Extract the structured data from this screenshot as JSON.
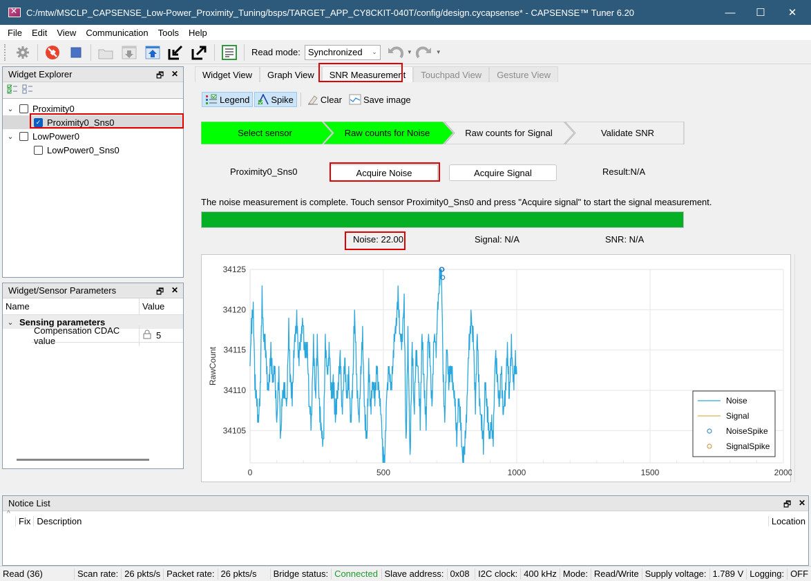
{
  "window": {
    "title": "C:/mtw/MSCLP_CAPSENSE_Low-Power_Proximity_Tuning/bsps/TARGET_APP_CY8CKIT-040T/config/design.cycapsense* - CAPSENSE™ Tuner 6.20",
    "minimize": "—",
    "maximize": "☐",
    "close": "✕"
  },
  "menu": [
    "File",
    "Edit",
    "View",
    "Communication",
    "Tools",
    "Help"
  ],
  "toolbar": {
    "icons": [
      "gear-icon",
      "disconnect-icon",
      "stop-icon",
      "open-folder-icon",
      "read-from-device-icon",
      "write-to-device-icon",
      "import-icon",
      "export-icon",
      "log-icon"
    ],
    "read_mode_label": "Read mode:",
    "read_mode_value": "Synchronized",
    "undo": "undo-icon",
    "redo": "redo-icon"
  },
  "widget_explorer": {
    "title": "Widget Explorer",
    "tree": [
      {
        "label": "Proximity0",
        "checked": false,
        "expanded": true,
        "children": [
          {
            "label": "Proximity0_Sns0",
            "checked": true,
            "selected": true
          }
        ]
      },
      {
        "label": "LowPower0",
        "checked": false,
        "expanded": true,
        "children": [
          {
            "label": "LowPower0_Sns0",
            "checked": false
          }
        ]
      }
    ]
  },
  "sensor_params": {
    "title": "Widget/Sensor Parameters",
    "col_name": "Name",
    "col_value": "Value",
    "group": "Sensing parameters",
    "rows": [
      {
        "name": "Compensation CDAC value",
        "value": "5",
        "locked": true
      }
    ]
  },
  "tabs": [
    {
      "label": "Widget View",
      "state": "normal"
    },
    {
      "label": "Graph View",
      "state": "normal"
    },
    {
      "label": "SNR Measurement",
      "state": "active"
    },
    {
      "label": "Touchpad View",
      "state": "disabled"
    },
    {
      "label": "Gesture View",
      "state": "disabled"
    }
  ],
  "snr_toolbar": {
    "legend": "Legend",
    "spike": "Spike",
    "clear": "Clear",
    "save_image": "Save image"
  },
  "steps": [
    {
      "label": "Select sensor",
      "done": true
    },
    {
      "label": "Raw counts for Noise",
      "done": true
    },
    {
      "label": "Raw counts for Signal",
      "done": false
    },
    {
      "label": "Validate SNR",
      "done": false
    }
  ],
  "measurement": {
    "sensor": "Proximity0_Sns0",
    "acquire_noise": "Acquire Noise",
    "acquire_signal": "Acquire Signal",
    "result": "Result:N/A",
    "message": "The noise measurement is complete. Touch sensor Proximity0_Sns0 and press \"Acquire signal\" to start the signal measurement.",
    "progress_percent": 100,
    "noise": "Noise:  22.00",
    "signal": "Signal:  N/A",
    "snr": "SNR:  N/A"
  },
  "colors": {
    "step_done": "#00ff00",
    "progress": "#06b025",
    "noise_line": "#2aa7dc",
    "signal_line": "#e0b050",
    "connected": "#1f9b2f",
    "highlight": "#e00000"
  },
  "chart_data": {
    "type": "line",
    "title": "",
    "xlabel": "",
    "ylabel": "RawCount",
    "xlim": [
      0,
      2000
    ],
    "ylim": [
      34101,
      34125
    ],
    "xticks": [
      0,
      500,
      1000,
      1500,
      2000
    ],
    "yticks": [
      34105,
      34110,
      34115,
      34120,
      34125
    ],
    "grid": true,
    "legend_position": "bottom-right",
    "legend": [
      "Noise",
      "Signal",
      "NoiseSpike",
      "SignalSpike"
    ],
    "series": [
      {
        "name": "Noise",
        "type": "line",
        "x_range": [
          0,
          1000
        ],
        "keypoints": [
          [
            0,
            34113
          ],
          [
            5,
            34118
          ],
          [
            12,
            34120
          ],
          [
            18,
            34111
          ],
          [
            25,
            34109
          ],
          [
            30,
            34106
          ],
          [
            38,
            34110
          ],
          [
            45,
            34122
          ],
          [
            50,
            34117
          ],
          [
            58,
            34115
          ],
          [
            65,
            34111
          ],
          [
            70,
            34110
          ],
          [
            78,
            34115
          ],
          [
            85,
            34111
          ],
          [
            92,
            34113
          ],
          [
            100,
            34106
          ],
          [
            108,
            34112
          ],
          [
            115,
            34104
          ],
          [
            122,
            34110
          ],
          [
            130,
            34110
          ],
          [
            138,
            34108
          ],
          [
            145,
            34118
          ],
          [
            150,
            34112
          ],
          [
            158,
            34109
          ],
          [
            165,
            34115
          ],
          [
            175,
            34119
          ],
          [
            182,
            34114
          ],
          [
            190,
            34116
          ],
          [
            198,
            34119
          ],
          [
            205,
            34115
          ],
          [
            215,
            34115
          ],
          [
            222,
            34108
          ],
          [
            230,
            34106
          ],
          [
            238,
            34116
          ],
          [
            245,
            34109
          ],
          [
            252,
            34116
          ],
          [
            260,
            34108
          ],
          [
            268,
            34105
          ],
          [
            275,
            34103
          ],
          [
            282,
            34116
          ],
          [
            290,
            34112
          ],
          [
            298,
            34115
          ],
          [
            305,
            34109
          ],
          [
            312,
            34111
          ],
          [
            320,
            34107
          ],
          [
            330,
            34110
          ],
          [
            338,
            34115
          ],
          [
            345,
            34107
          ],
          [
            355,
            34114
          ],
          [
            362,
            34109
          ],
          [
            370,
            34112
          ],
          [
            378,
            34106
          ],
          [
            385,
            34111
          ],
          [
            392,
            34120
          ],
          [
            400,
            34111
          ],
          [
            408,
            34106
          ],
          [
            415,
            34112
          ],
          [
            422,
            34117
          ],
          [
            430,
            34107
          ],
          [
            438,
            34104
          ],
          [
            445,
            34113
          ],
          [
            452,
            34108
          ],
          [
            460,
            34111
          ],
          [
            468,
            34109
          ],
          [
            475,
            34113
          ],
          [
            482,
            34110
          ],
          [
            490,
            34108
          ],
          [
            498,
            34102
          ],
          [
            505,
            34101
          ],
          [
            512,
            34109
          ],
          [
            520,
            34113
          ],
          [
            530,
            34110
          ],
          [
            540,
            34116
          ],
          [
            548,
            34118
          ],
          [
            555,
            34122
          ],
          [
            562,
            34117
          ],
          [
            570,
            34116
          ],
          [
            578,
            34121
          ],
          [
            585,
            34103
          ],
          [
            592,
            34117
          ],
          [
            600,
            34101
          ],
          [
            608,
            34116
          ],
          [
            615,
            34107
          ],
          [
            622,
            34114
          ],
          [
            630,
            34113
          ],
          [
            638,
            34106
          ],
          [
            645,
            34117
          ],
          [
            652,
            34111
          ],
          [
            660,
            34106
          ],
          [
            668,
            34117
          ],
          [
            675,
            34114
          ],
          [
            682,
            34108
          ],
          [
            690,
            34117
          ],
          [
            698,
            34115
          ],
          [
            705,
            34121
          ],
          [
            712,
            34124
          ],
          [
            718,
            34125
          ],
          [
            724,
            34112
          ],
          [
            730,
            34106
          ],
          [
            738,
            34116
          ],
          [
            745,
            34111
          ],
          [
            752,
            34113
          ],
          [
            760,
            34111
          ],
          [
            768,
            34109
          ],
          [
            775,
            34104
          ],
          [
            782,
            34109
          ],
          [
            790,
            34106
          ],
          [
            798,
            34101
          ],
          [
            805,
            34103
          ],
          [
            812,
            34107
          ],
          [
            820,
            34115
          ],
          [
            830,
            34119
          ],
          [
            838,
            34116
          ],
          [
            845,
            34108
          ],
          [
            852,
            34117
          ],
          [
            860,
            34109
          ],
          [
            868,
            34106
          ],
          [
            875,
            34103
          ],
          [
            882,
            34111
          ],
          [
            890,
            34107
          ],
          [
            898,
            34104
          ],
          [
            905,
            34106
          ],
          [
            912,
            34104
          ],
          [
            920,
            34115
          ],
          [
            928,
            34111
          ],
          [
            935,
            34108
          ],
          [
            942,
            34113
          ],
          [
            950,
            34107
          ],
          [
            958,
            34110
          ],
          [
            965,
            34115
          ],
          [
            972,
            34109
          ],
          [
            980,
            34116
          ],
          [
            988,
            34111
          ],
          [
            995,
            34114
          ],
          [
            1000,
            34112
          ]
        ]
      },
      {
        "name": "Signal",
        "type": "line",
        "values": []
      },
      {
        "name": "NoiseSpike",
        "type": "scatter",
        "points": [
          [
            718,
            34125
          ],
          [
            720,
            34125
          ],
          [
            722,
            34124
          ]
        ]
      },
      {
        "name": "SignalSpike",
        "type": "scatter",
        "points": []
      }
    ]
  },
  "notice_list": {
    "title": "Notice List",
    "columns": [
      "Fix",
      "Description",
      "Location"
    ]
  },
  "status_bar": {
    "read": "Read (36)",
    "scan_rate_label": "Scan rate:",
    "scan_rate": "26 pkts/s",
    "packet_rate_label": "Packet rate:",
    "packet_rate": "26 pkts/s",
    "bridge_label": "Bridge status:",
    "bridge": "Connected",
    "slave_label": "Slave address:",
    "slave": "0x08",
    "i2c_label": "I2C clock:",
    "i2c": "400 kHz",
    "mode_label": "Mode:",
    "mode": "Read/Write",
    "supply_label": "Supply voltage:",
    "supply": "1.789 V",
    "logging_label": "Logging:",
    "logging": "OFF"
  }
}
